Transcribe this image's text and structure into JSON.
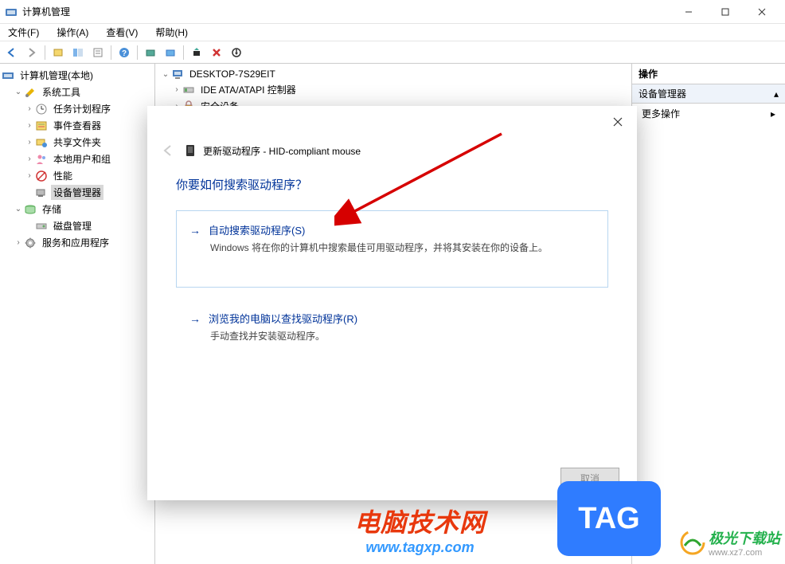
{
  "window": {
    "title": "计算机管理",
    "min_tooltip": "最小化",
    "max_tooltip": "最大化",
    "close_tooltip": "关闭"
  },
  "menu": {
    "file": "文件(F)",
    "action": "操作(A)",
    "view": "查看(V)",
    "help": "帮助(H)"
  },
  "left_tree": {
    "root": "计算机管理(本地)",
    "system_tools": "系统工具",
    "task_scheduler": "任务计划程序",
    "event_viewer": "事件查看器",
    "shared_folders": "共享文件夹",
    "local_users": "本地用户和组",
    "performance": "性能",
    "device_manager": "设备管理器",
    "storage": "存储",
    "disk_management": "磁盘管理",
    "services": "服务和应用程序"
  },
  "center_tree": {
    "computer": "DESKTOP-7S29EIT",
    "ide": "IDE ATA/ATAPI 控制器",
    "security_devices": "安全设备"
  },
  "right_pane": {
    "header": "操作",
    "section_device_mgr": "设备管理器",
    "more_actions": "更多操作"
  },
  "dialog": {
    "title": "更新驱动程序 - HID-compliant mouse",
    "question": "你要如何搜索驱动程序？",
    "option1_title": "自动搜索驱动程序(S)",
    "option1_desc": "Windows 将在你的计算机中搜索最佳可用驱动程序，并将其安装在你的设备上。",
    "option2_title": "浏览我的电脑以查找驱动程序(R)",
    "option2_desc": "手动查找并安装驱动程序。",
    "cancel": "取消"
  },
  "watermarks": {
    "wm1_t1": "电脑技术网",
    "wm1_t2": "www.tagxp.com",
    "wm2": "TAG",
    "wm3_text": "极光下载站",
    "wm3_url": "www.xz7.com"
  }
}
